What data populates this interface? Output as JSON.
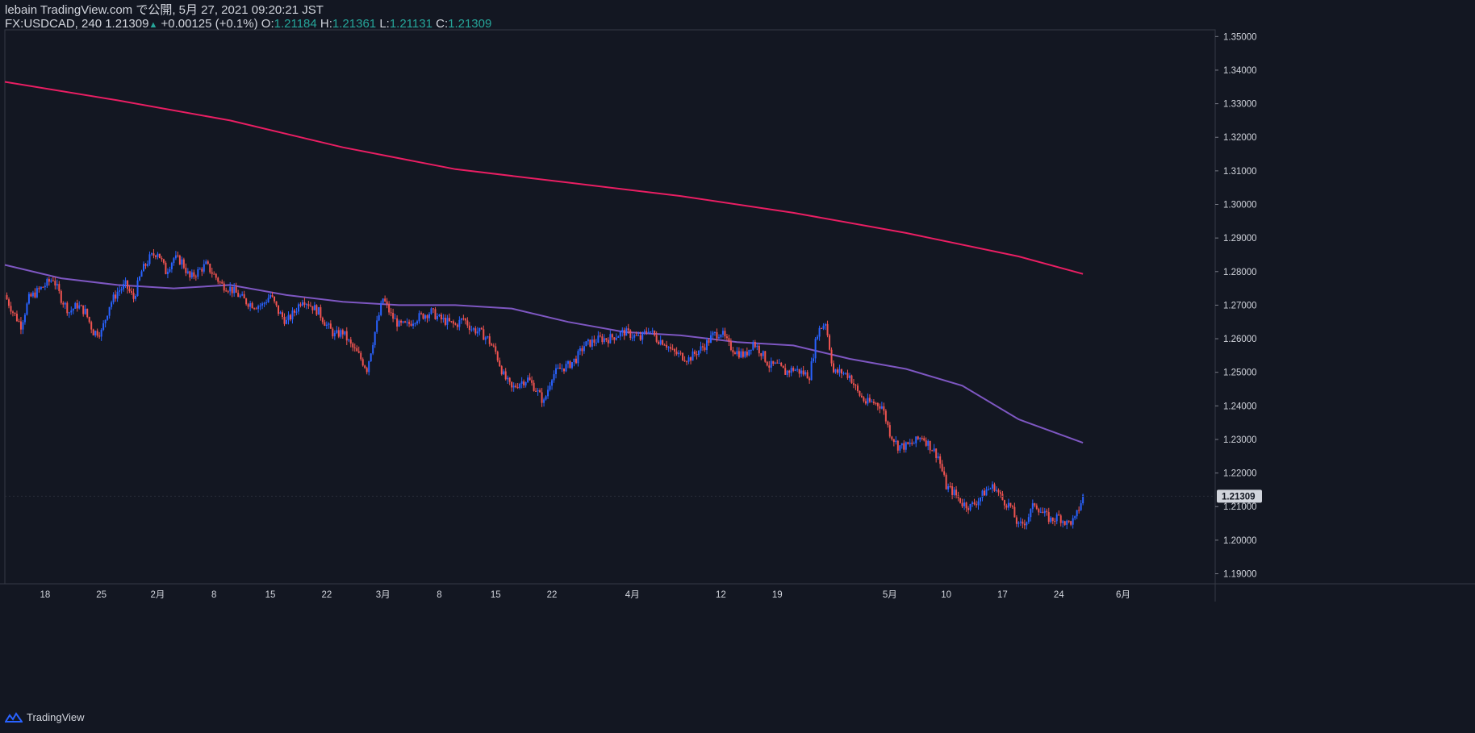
{
  "header": {
    "line1": "lebain TradingView.com で公開, 5月 27, 2021 09:20:21 JST",
    "symbol": "FX:USDCAD, 240",
    "last": "1.21309",
    "change": "+0.00125 (+0.1%)",
    "o_label": "O:",
    "o_value": "1.21184",
    "h_label": "H:",
    "h_value": "1.21361",
    "l_label": "L:",
    "l_value": "1.21131",
    "c_label": "C:",
    "c_value": "1.21309"
  },
  "footer": {
    "brand": "TradingView",
    "logo_icon": "tradingview-logo-icon"
  },
  "colors": {
    "background": "#131722",
    "up": "#2962ff",
    "down": "#ef5350",
    "ma_fast": "#7e57c2",
    "ma_slow": "#e91e63",
    "axis_text": "#d1d4dc"
  },
  "chart_data": {
    "type": "candlestick",
    "symbol": "FX:USDCAD",
    "interval": "240",
    "ylim": [
      1.187,
      1.352
    ],
    "y_ticks": [
      "1.35000",
      "1.34000",
      "1.33000",
      "1.32000",
      "1.31000",
      "1.30000",
      "1.29000",
      "1.28000",
      "1.27000",
      "1.26000",
      "1.25000",
      "1.24000",
      "1.23000",
      "1.22000",
      "1.21000",
      "1.20000",
      "1.19000"
    ],
    "x_ticks": [
      "18",
      "25",
      "2月",
      "8",
      "15",
      "22",
      "3月",
      "8",
      "15",
      "22",
      "4月",
      "12",
      "19",
      "5月",
      "10",
      "17",
      "24",
      "6月"
    ],
    "x_tick_dates": [
      "2021-01-18",
      "2021-01-25",
      "2021-02-01",
      "2021-02-08",
      "2021-02-15",
      "2021-02-22",
      "2021-03-01",
      "2021-03-08",
      "2021-03-15",
      "2021-03-22",
      "2021-04-01",
      "2021-04-12",
      "2021-04-19",
      "2021-05-03",
      "2021-05-10",
      "2021-05-17",
      "2021-05-24",
      "2021-06-01"
    ],
    "last_price": "1.21309",
    "close_path": [
      [
        "2021-01-13",
        1.273
      ],
      [
        "2021-01-14",
        1.268
      ],
      [
        "2021-01-15",
        1.264
      ],
      [
        "2021-01-16",
        1.272
      ],
      [
        "2021-01-18",
        1.276
      ],
      [
        "2021-01-19",
        1.278
      ],
      [
        "2021-01-20",
        1.272
      ],
      [
        "2021-01-21",
        1.268
      ],
      [
        "2021-01-22",
        1.27
      ],
      [
        "2021-01-23",
        1.268
      ],
      [
        "2021-01-24",
        1.262
      ],
      [
        "2021-01-25",
        1.262
      ],
      [
        "2021-01-26",
        1.27
      ],
      [
        "2021-01-27",
        1.274
      ],
      [
        "2021-01-28",
        1.276
      ],
      [
        "2021-01-29",
        1.272
      ],
      [
        "2021-01-30",
        1.28
      ],
      [
        "2021-01-31",
        1.284
      ],
      [
        "2021-02-01",
        1.286
      ],
      [
        "2021-02-02",
        1.28
      ],
      [
        "2021-02-03",
        1.284
      ],
      [
        "2021-02-04",
        1.283
      ],
      [
        "2021-02-05",
        1.278
      ],
      [
        "2021-02-06",
        1.28
      ],
      [
        "2021-02-07",
        1.282
      ],
      [
        "2021-02-08",
        1.279
      ],
      [
        "2021-02-09",
        1.276
      ],
      [
        "2021-02-10",
        1.275
      ],
      [
        "2021-02-11",
        1.273
      ],
      [
        "2021-02-12",
        1.271
      ],
      [
        "2021-02-13",
        1.27
      ],
      [
        "2021-02-14",
        1.27
      ],
      [
        "2021-02-15",
        1.273
      ],
      [
        "2021-02-16",
        1.268
      ],
      [
        "2021-02-17",
        1.265
      ],
      [
        "2021-02-18",
        1.268
      ],
      [
        "2021-02-19",
        1.272
      ],
      [
        "2021-02-20",
        1.27
      ],
      [
        "2021-02-21",
        1.268
      ],
      [
        "2021-02-22",
        1.264
      ],
      [
        "2021-02-23",
        1.261
      ],
      [
        "2021-02-24",
        1.262
      ],
      [
        "2021-02-25",
        1.258
      ],
      [
        "2021-02-26",
        1.255
      ],
      [
        "2021-02-27",
        1.251
      ],
      [
        "2021-02-28",
        1.262
      ],
      [
        "2021-03-01",
        1.272
      ],
      [
        "2021-03-02",
        1.267
      ],
      [
        "2021-03-03",
        1.264
      ],
      [
        "2021-03-04",
        1.264
      ],
      [
        "2021-03-05",
        1.266
      ],
      [
        "2021-03-06",
        1.267
      ],
      [
        "2021-03-07",
        1.268
      ],
      [
        "2021-03-08",
        1.266
      ],
      [
        "2021-03-09",
        1.265
      ],
      [
        "2021-03-10",
        1.264
      ],
      [
        "2021-03-11",
        1.266
      ],
      [
        "2021-03-12",
        1.263
      ],
      [
        "2021-03-13",
        1.262
      ],
      [
        "2021-03-14",
        1.26
      ],
      [
        "2021-03-15",
        1.256
      ],
      [
        "2021-03-16",
        1.249
      ],
      [
        "2021-03-17",
        1.245
      ],
      [
        "2021-03-18",
        1.247
      ],
      [
        "2021-03-19",
        1.248
      ],
      [
        "2021-03-20",
        1.245
      ],
      [
        "2021-03-21",
        1.241
      ],
      [
        "2021-03-22",
        1.249
      ],
      [
        "2021-03-23",
        1.251
      ],
      [
        "2021-03-24",
        1.252
      ],
      [
        "2021-03-25",
        1.254
      ],
      [
        "2021-03-26",
        1.258
      ],
      [
        "2021-03-27",
        1.259
      ],
      [
        "2021-03-28",
        1.26
      ],
      [
        "2021-03-29",
        1.26
      ],
      [
        "2021-03-30",
        1.261
      ],
      [
        "2021-03-31",
        1.262
      ],
      [
        "2021-04-01",
        1.261
      ],
      [
        "2021-04-02",
        1.26
      ],
      [
        "2021-04-03",
        1.263
      ],
      [
        "2021-04-04",
        1.26
      ],
      [
        "2021-04-05",
        1.259
      ],
      [
        "2021-04-06",
        1.256
      ],
      [
        "2021-04-07",
        1.255
      ],
      [
        "2021-04-08",
        1.254
      ],
      [
        "2021-04-09",
        1.256
      ],
      [
        "2021-04-10",
        1.258
      ],
      [
        "2021-04-11",
        1.261
      ],
      [
        "2021-04-12",
        1.262
      ],
      [
        "2021-04-13",
        1.258
      ],
      [
        "2021-04-14",
        1.256
      ],
      [
        "2021-04-15",
        1.255
      ],
      [
        "2021-04-16",
        1.259
      ],
      [
        "2021-04-17",
        1.256
      ],
      [
        "2021-04-18",
        1.252
      ],
      [
        "2021-04-19",
        1.252
      ],
      [
        "2021-04-20",
        1.25
      ],
      [
        "2021-04-21",
        1.251
      ],
      [
        "2021-04-22",
        1.25
      ],
      [
        "2021-04-23",
        1.249
      ],
      [
        "2021-04-24",
        1.262
      ],
      [
        "2021-04-25",
        1.265
      ],
      [
        "2021-04-26",
        1.25
      ],
      [
        "2021-04-27",
        1.25
      ],
      [
        "2021-04-28",
        1.249
      ],
      [
        "2021-04-29",
        1.244
      ],
      [
        "2021-04-30",
        1.241
      ],
      [
        "2021-05-01",
        1.241
      ],
      [
        "2021-05-02",
        1.24
      ],
      [
        "2021-05-03",
        1.232
      ],
      [
        "2021-05-04",
        1.228
      ],
      [
        "2021-05-05",
        1.228
      ],
      [
        "2021-05-06",
        1.229
      ],
      [
        "2021-05-07",
        1.231
      ],
      [
        "2021-05-08",
        1.228
      ],
      [
        "2021-05-09",
        1.225
      ],
      [
        "2021-05-10",
        1.216
      ],
      [
        "2021-05-11",
        1.214
      ],
      [
        "2021-05-12",
        1.211
      ],
      [
        "2021-05-13",
        1.21
      ],
      [
        "2021-05-14",
        1.212
      ],
      [
        "2021-05-15",
        1.215
      ],
      [
        "2021-05-16",
        1.216
      ],
      [
        "2021-05-17",
        1.212
      ],
      [
        "2021-05-18",
        1.21
      ],
      [
        "2021-05-19",
        1.204
      ],
      [
        "2021-05-20",
        1.206
      ],
      [
        "2021-05-21",
        1.211
      ],
      [
        "2021-05-22",
        1.208
      ],
      [
        "2021-05-23",
        1.206
      ],
      [
        "2021-05-24",
        1.207
      ],
      [
        "2021-05-25",
        1.205
      ],
      [
        "2021-05-26",
        1.206
      ],
      [
        "2021-05-27",
        1.21309
      ]
    ],
    "series": [
      {
        "values": [
          [
            "2021-01-13",
            1.282
          ],
          [
            "2021-01-20",
            1.278
          ],
          [
            "2021-01-27",
            1.276
          ],
          [
            "2021-02-03",
            1.275
          ],
          [
            "2021-02-10",
            1.276
          ],
          [
            "2021-02-17",
            1.273
          ],
          [
            "2021-02-24",
            1.271
          ],
          [
            "2021-03-03",
            1.27
          ],
          [
            "2021-03-10",
            1.27
          ],
          [
            "2021-03-17",
            1.269
          ],
          [
            "2021-03-24",
            1.265
          ],
          [
            "2021-03-31",
            1.262
          ],
          [
            "2021-04-07",
            1.261
          ],
          [
            "2021-04-14",
            1.259
          ],
          [
            "2021-04-21",
            1.258
          ],
          [
            "2021-04-28",
            1.254
          ],
          [
            "2021-05-05",
            1.251
          ],
          [
            "2021-05-12",
            1.246
          ],
          [
            "2021-05-19",
            1.236
          ],
          [
            "2021-05-27",
            1.229
          ]
        ]
      },
      {
        "values": [
          [
            "2021-01-13",
            1.3365
          ],
          [
            "2021-01-27",
            1.331
          ],
          [
            "2021-02-10",
            1.325
          ],
          [
            "2021-02-24",
            1.317
          ],
          [
            "2021-03-10",
            1.3105
          ],
          [
            "2021-03-24",
            1.3065
          ],
          [
            "2021-04-07",
            1.3025
          ],
          [
            "2021-04-21",
            1.2975
          ],
          [
            "2021-05-05",
            1.2915
          ],
          [
            "2021-05-19",
            1.2845
          ],
          [
            "2021-05-27",
            1.2793
          ]
        ]
      }
    ]
  }
}
